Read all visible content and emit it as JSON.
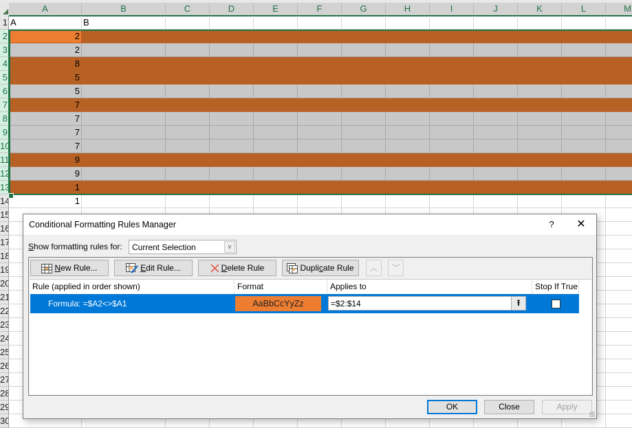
{
  "sheet": {
    "columns": [
      "A",
      "B",
      "C",
      "D",
      "E",
      "F",
      "G",
      "H",
      "I",
      "J",
      "K",
      "L",
      "M"
    ],
    "header_row": {
      "row": "1",
      "A": "A",
      "B": "B"
    },
    "rows": [
      {
        "row": "2",
        "a": "2",
        "style": "orange",
        "active": true
      },
      {
        "row": "3",
        "a": "2",
        "style": "gray"
      },
      {
        "row": "4",
        "a": "8",
        "style": "orange"
      },
      {
        "row": "5",
        "a": "5",
        "style": "orange"
      },
      {
        "row": "6",
        "a": "5",
        "style": "gray"
      },
      {
        "row": "7",
        "a": "7",
        "style": "orange"
      },
      {
        "row": "8",
        "a": "7",
        "style": "gray"
      },
      {
        "row": "9",
        "a": "7",
        "style": "gray"
      },
      {
        "row": "10",
        "a": "7",
        "style": "gray"
      },
      {
        "row": "11",
        "a": "9",
        "style": "orange"
      },
      {
        "row": "12",
        "a": "9",
        "style": "gray"
      },
      {
        "row": "13",
        "a": "1",
        "style": "orange"
      },
      {
        "row": "14",
        "a": "1",
        "style": "plain"
      }
    ],
    "extra_row_numbers": [
      "15",
      "16",
      "17",
      "18",
      "19",
      "20",
      "21",
      "22",
      "23",
      "24",
      "25",
      "26",
      "27",
      "28",
      "29",
      "30"
    ],
    "colors": {
      "highlight": "#b86125",
      "active_cell": "#ed7d31",
      "gray_row": "#c8c8c8",
      "selection": "#217346"
    }
  },
  "dialog": {
    "title": "Conditional Formatting Rules Manager",
    "help_label": "?",
    "close_label": "✕",
    "show_rules_label_prefix": "S",
    "show_rules_label_rest": "how formatting rules for:",
    "show_rules_value": "Current Selection",
    "toolbar": {
      "new_rule": {
        "u": "N",
        "rest": "ew Rule..."
      },
      "edit_rule": {
        "u": "E",
        "rest": "dit Rule..."
      },
      "delete_rule": {
        "u": "D",
        "rest": "elete Rule"
      },
      "duplicate_rule": {
        "pre": "Dupli",
        "u": "c",
        "rest": "ate Rule"
      },
      "move_up": "︿",
      "move_down": "﹀"
    },
    "columns": {
      "rule": "Rule (applied in order shown)",
      "format": "Format",
      "applies_to": "Applies to",
      "stop_if_true": "Stop If True"
    },
    "rules": [
      {
        "formula": "Formula: =$A2<>$A1",
        "format_preview": "AaBbCcYyZz",
        "format_color": "#ed7d31",
        "applies_to": "=$2:$14",
        "stop_if_true": false,
        "selected": true
      }
    ],
    "buttons": {
      "ok": "OK",
      "close": "Close",
      "apply": "Apply"
    },
    "accent": "#0078d7"
  }
}
